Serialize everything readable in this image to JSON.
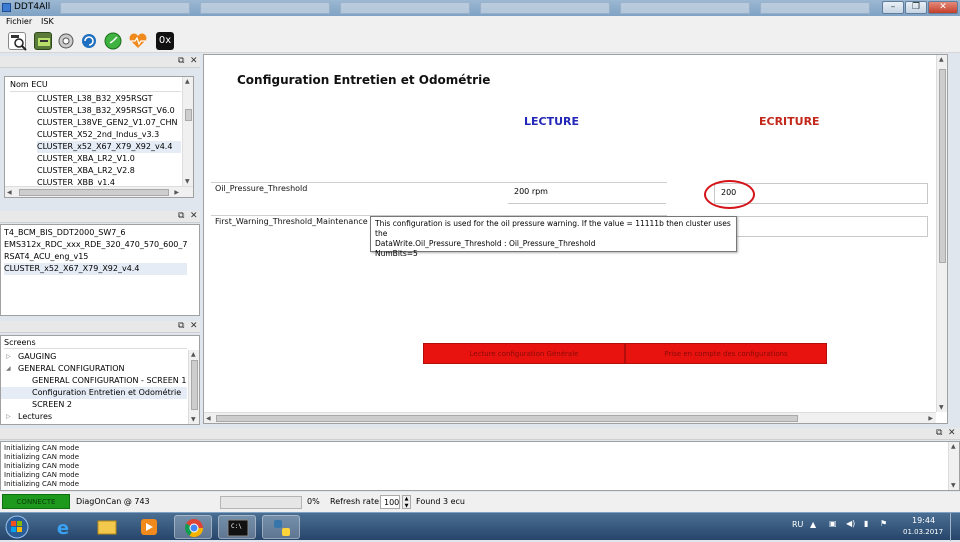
{
  "window": {
    "title": "DDT4All"
  },
  "menu": {
    "items": [
      "Fichier",
      "ISK"
    ]
  },
  "toolbar": {
    "icons": [
      "scan-icon",
      "dashboard-icon",
      "connect-icon",
      "refresh-icon",
      "clock-icon",
      "heart-icon"
    ],
    "hex_label": "0x"
  },
  "ecu_panel": {
    "header": "Nom ECU",
    "items": [
      "CLUSTER_L38_B32_X95RSGT",
      "CLUSTER_L38_B32_X95RSGT_V6.0",
      "CLUSTER_L38VE_GEN2_V1.07_CHN",
      "CLUSTER_X52_2nd_Indus_v3.3",
      "CLUSTER_x52_X67_X79_X92_v4.4",
      "CLUSTER_XBA_LR2_V1.0",
      "CLUSTER_XBA_LR2_V2.8",
      "CLUSTER_XBB_v1.4"
    ],
    "selected_index": 4
  },
  "found_panel": {
    "items": [
      "T4_BCM_BIS_DDT2000_SW7_6",
      "EMS312x_RDC_xxx_RDE_320_470_570_600_710_V01",
      "RSAT4_ACU_eng_v15",
      "CLUSTER_x52_X67_X79_X92_v4.4"
    ],
    "selected_index": 3
  },
  "screens_panel": {
    "header": "Screens",
    "items": [
      {
        "label": "GAUGING",
        "level": 0,
        "expander": "▷"
      },
      {
        "label": "GENERAL CONFIGURATION",
        "level": 0,
        "expander": "◢"
      },
      {
        "label": "GENERAL CONFIGURATION - SCREEN 1",
        "level": 1,
        "expander": ""
      },
      {
        "label": "Configuration Entretien et Odométrie",
        "level": 1,
        "expander": ""
      },
      {
        "label": "SCREEN 2",
        "level": 1,
        "expander": ""
      },
      {
        "label": "Lectures",
        "level": 0,
        "expander": "▷"
      }
    ],
    "selected_index": 3
  },
  "main": {
    "title": "Configuration Entretien et Odométrie",
    "lecture_header": "LECTURE",
    "ecriture_header": "ECRITURE",
    "fields": [
      {
        "label": "Oil_Pressure_Threshold",
        "read_value": "200 rpm",
        "write_value": "200"
      },
      {
        "label": "First_Warning_Threshold_Maintenance",
        "read_value": "",
        "write_value": ""
      }
    ],
    "buttons": {
      "read_config": "Lecture configuration Générale",
      "apply_config": "Prise en compte des configurations"
    },
    "tooltip": {
      "line1": "This configuration is used for the oil pressure warning. If the value = 11111b then cluster uses the",
      "line2": "DataWrite.Oil_Pressure_Threshold : Oil_Pressure_Threshold",
      "line3": "NumBits=5"
    }
  },
  "log": {
    "lines": [
      "Initializing CAN mode",
      "Initializing CAN mode",
      "Initializing CAN mode",
      "Initializing CAN mode",
      "Initializing CAN mode"
    ]
  },
  "status": {
    "connection": "CONNECTE",
    "protocol": "DiagOnCan @ 743",
    "progress_label": "0%",
    "progress": 0,
    "refresh_label": "Refresh rate:",
    "refresh_value": "100",
    "found": "Found 3 ecu"
  },
  "taskbar": {
    "lang": "RU",
    "time": "19:44",
    "date": "01.03.2017"
  },
  "colors": {
    "ecriture": "#c3271a",
    "lecture": "#2327b8",
    "connected": "#1d9a1d",
    "button": "#e8130f"
  }
}
